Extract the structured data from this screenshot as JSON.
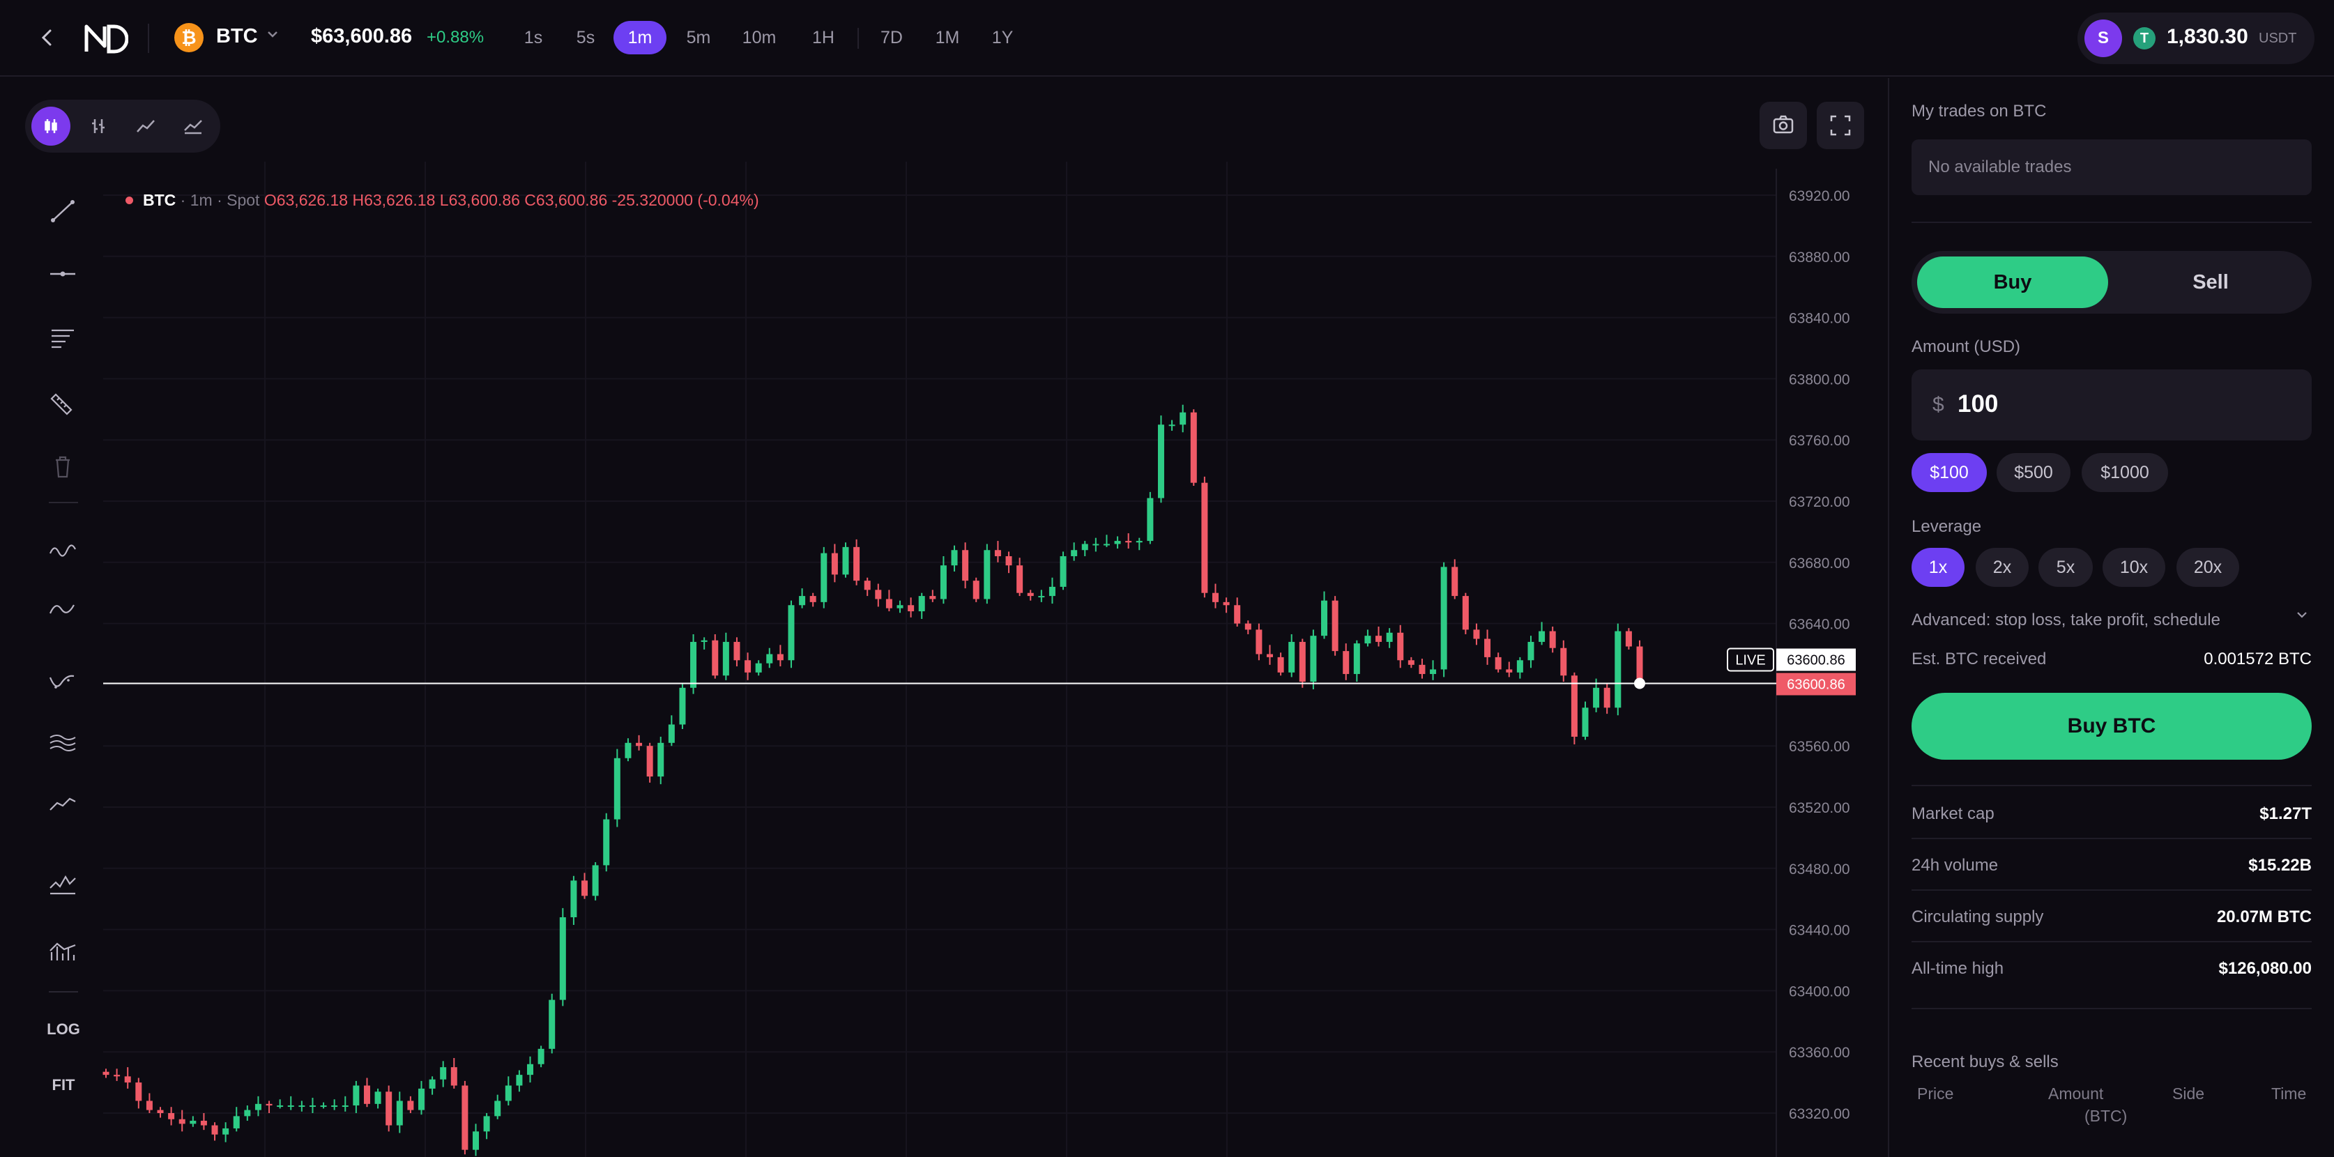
{
  "header": {
    "back_icon": "chevron-left-icon",
    "logo": "ND",
    "asset_symbol": "BTC",
    "asset_icon_glyph": "₿",
    "price": "$63,600.86",
    "change": "+0.88%",
    "timeframes": [
      "1s",
      "5s",
      "1m",
      "5m",
      "10m",
      "1H",
      "7D",
      "1M",
      "1Y"
    ],
    "active_timeframe": "1m",
    "account_initial": "S",
    "balance_currency_glyph": "T",
    "balance": "1,830.30",
    "balance_unit": "USDT"
  },
  "chart_toolbar": {
    "types": [
      "candles-icon",
      "bars-icon",
      "line-icon",
      "area-icon"
    ],
    "active_type": "candles-icon",
    "screenshot_icon": "camera-icon",
    "fullscreen_icon": "fullscreen-icon"
  },
  "drawing_tools": [
    "trend-line-icon",
    "horizontal-line-icon",
    "text-lines-icon",
    "ruler-icon",
    "trash-icon",
    "wave-icon",
    "sine-icon",
    "indicator-icon",
    "channels-icon",
    "moving-average-icon",
    "oscillator-icon",
    "volume-profile-icon"
  ],
  "scale_buttons": {
    "log": "LOG",
    "fit": "FIT"
  },
  "legend": {
    "symbol": "BTC",
    "interval": "· 1m",
    "market": "· Spot",
    "o_label": "O",
    "o": "63,626.18",
    "h_label": "H",
    "h": "63,626.18",
    "l_label": "L",
    "l": "63,600.86",
    "c_label": "C",
    "c": "63,600.86",
    "delta": "-25.320000 (-0.04%)"
  },
  "chart_data": {
    "type": "candlestick",
    "y_ticks": [
      "63920.00",
      "63880.00",
      "63840.00",
      "63800.00",
      "63760.00",
      "63720.00",
      "63680.00",
      "63640.00",
      "63600.00",
      "63560.00",
      "63520.00",
      "63480.00",
      "63440.00",
      "63400.00",
      "63360.00",
      "63320.00"
    ],
    "ylim": [
      63300,
      63940
    ],
    "live_label": "LIVE",
    "live_value": "63600.86",
    "live_price_badge": "63600.86",
    "last_price": 63600.86,
    "closes": [
      63345,
      63344,
      63340,
      63328,
      63322,
      63320,
      63316,
      63313,
      63315,
      63312,
      63306,
      63310,
      63318,
      63322,
      63326,
      63325,
      63325,
      63325,
      63325,
      63325,
      63325,
      63325,
      63325,
      63338,
      63326,
      63334,
      63312,
      63328,
      63322,
      63336,
      63342,
      63350,
      63338,
      63296,
      63308,
      63318,
      63328,
      63338,
      63345,
      63352,
      63362,
      63394,
      63448,
      63472,
      63462,
      63482,
      63512,
      63552,
      63562,
      63560,
      63540,
      63562,
      63574,
      63598,
      63628,
      63629,
      63606,
      63628,
      63616,
      63608,
      63614,
      63620,
      63616,
      63652,
      63658,
      63654,
      63686,
      63672,
      63690,
      63668,
      63662,
      63656,
      63650,
      63652,
      63648,
      63658,
      63656,
      63678,
      63688,
      63668,
      63656,
      63688,
      63684,
      63678,
      63660,
      63658,
      63658,
      63664,
      63684,
      63688,
      63692,
      63692,
      63692,
      63694,
      63693,
      63694,
      63722,
      63770,
      63770,
      63778,
      63732,
      63660,
      63654,
      63652,
      63640,
      63636,
      63620,
      63618,
      63608,
      63628,
      63602,
      63632,
      63655,
      63622,
      63607,
      63627,
      63632,
      63628,
      63634,
      63616,
      63613,
      63607,
      63610,
      63677,
      63658,
      63636,
      63630,
      63618,
      63610,
      63608,
      63616,
      63628,
      63635,
      63624,
      63606,
      63566,
      63585,
      63598,
      63585,
      63635,
      63625,
      63600.86
    ]
  },
  "panel": {
    "my_trades_label": "My trades on BTC",
    "no_trades": "No available trades",
    "buy_tab": "Buy",
    "sell_tab": "Sell",
    "amount_label": "Amount (USD)",
    "amount_prefix": "$",
    "amount_value": "100",
    "quick_amounts": [
      "$100",
      "$500",
      "$1000"
    ],
    "leverage_label": "Leverage",
    "leverages": [
      "1x",
      "2x",
      "5x",
      "10x",
      "20x"
    ],
    "advanced": "Advanced: stop loss, take profit, schedule",
    "advanced_chevron": "chevron-down-icon",
    "est_label": "Est. BTC received",
    "est_value": "0.001572 BTC",
    "buy_button": "Buy BTC",
    "stats": [
      {
        "label": "Market cap",
        "value": "$1.27T"
      },
      {
        "label": "24h volume",
        "value": "$15.22B"
      },
      {
        "label": "Circulating supply",
        "value": "20.07M BTC"
      },
      {
        "label": "All-time high",
        "value": "$126,080.00"
      }
    ],
    "recent_label": "Recent buys & sells",
    "recent_columns": [
      "Price",
      "Amount",
      "(BTC)",
      "Side",
      "Time"
    ]
  },
  "colors": {
    "up": "#2ecc86",
    "down": "#ef5a67",
    "accent": "#6d3ff2",
    "bg": "#0d0b12"
  }
}
